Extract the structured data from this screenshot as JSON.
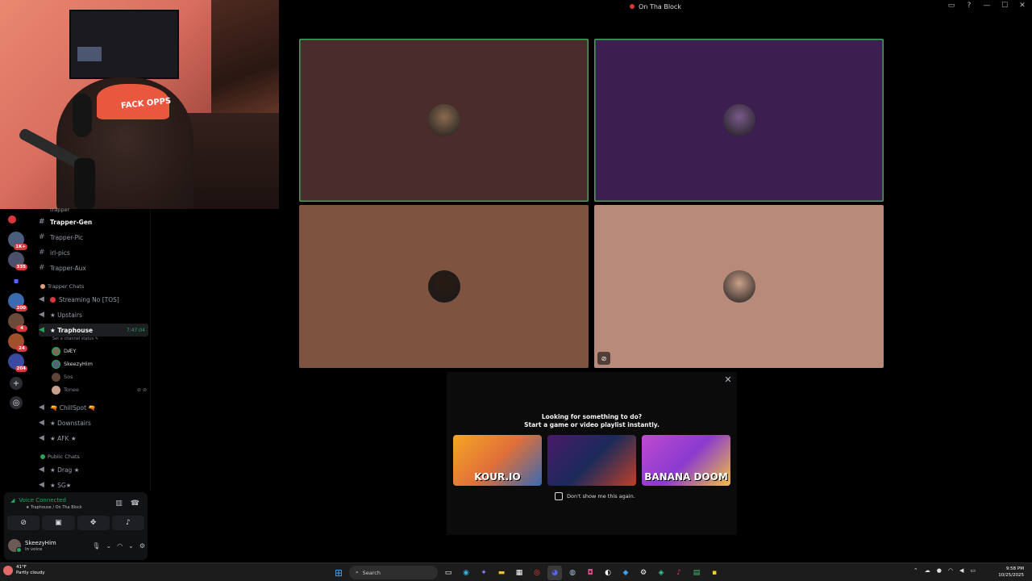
{
  "window": {
    "title": "On Tha Block",
    "controls": [
      "inbox-icon",
      "help-icon",
      "minimize-icon",
      "maximize-icon",
      "close-icon"
    ]
  },
  "webcam": {
    "cap_text": "FACK OPPS"
  },
  "servers": [
    {
      "icon": "server-red",
      "badge": ""
    },
    {
      "icon": "server-avatar",
      "badge": "1K+"
    },
    {
      "icon": "server-avatar",
      "badge": "335"
    },
    {
      "icon": "folder-icon",
      "badge": ""
    },
    {
      "icon": "server-avatar",
      "badge": "200"
    },
    {
      "icon": "server-avatar",
      "badge": "4"
    },
    {
      "icon": "server-avatar",
      "badge": "24"
    },
    {
      "icon": "server-avatar",
      "badge": "204"
    }
  ],
  "sidebar": {
    "top_category": "trapper",
    "channels_top": [
      {
        "name": "Trapper-Gen",
        "type": "text",
        "bold": true
      },
      {
        "name": "Trapper-Pic",
        "type": "text",
        "bold": false
      },
      {
        "name": "irl-pics",
        "type": "text",
        "bold": false
      },
      {
        "name": "Trapper-Aux",
        "type": "text",
        "bold": false
      }
    ],
    "category_trapper_chats": "Trapper Chats",
    "streaming_channel": "Streaming No [TOS]",
    "upstairs": "★ Upstairs",
    "traphouse": "★ Traphouse",
    "traphouse_timer": "7:47:04",
    "set_status": "Set a channel status",
    "voice_users": [
      {
        "name": "DÆY",
        "dim": false
      },
      {
        "name": "SkeezyHim",
        "dim": false
      },
      {
        "name": "Sos",
        "dim": true
      },
      {
        "name": "Tonee",
        "dim": true
      }
    ],
    "chillspot": "🔫 ChillSpot 🔫",
    "downstairs": "★ Downstairs",
    "afk": "★ AFK ★",
    "category_public": "Public Chats",
    "drag": "★ Drag ★",
    "sg": "★ SG★"
  },
  "voice": {
    "status": "Voice Connected",
    "location": "★ Traphouse / On Tha Block"
  },
  "user": {
    "name": "SkeezyHim",
    "status": "In voice"
  },
  "tiles": [
    {
      "bg": "#4a2c2c",
      "speaking": true,
      "avatar": "#8a6a50"
    },
    {
      "bg": "#3c1e50",
      "speaking": true,
      "avatar": "#7a5a8a"
    },
    {
      "bg": "#7e5441",
      "speaking": false,
      "avatar": "#2a1a14"
    },
    {
      "bg": "#b88a7a",
      "speaking": false,
      "avatar": "#caa08a"
    }
  ],
  "popup": {
    "line1": "Looking for something to do?",
    "line2": "Start a game or video playlist instantly.",
    "games": [
      "KOUR.IO",
      "",
      "BANANA DOOM"
    ],
    "dont_show": "Don't show me this again."
  },
  "taskbar": {
    "temp": "41°F",
    "weather": "Partly cloudy",
    "search": "Search",
    "time": "9:58 PM",
    "date": "10/25/2025"
  },
  "colors": {
    "speaking": "#3ba55c",
    "badge": "#da373c",
    "online": "#23a55a"
  }
}
